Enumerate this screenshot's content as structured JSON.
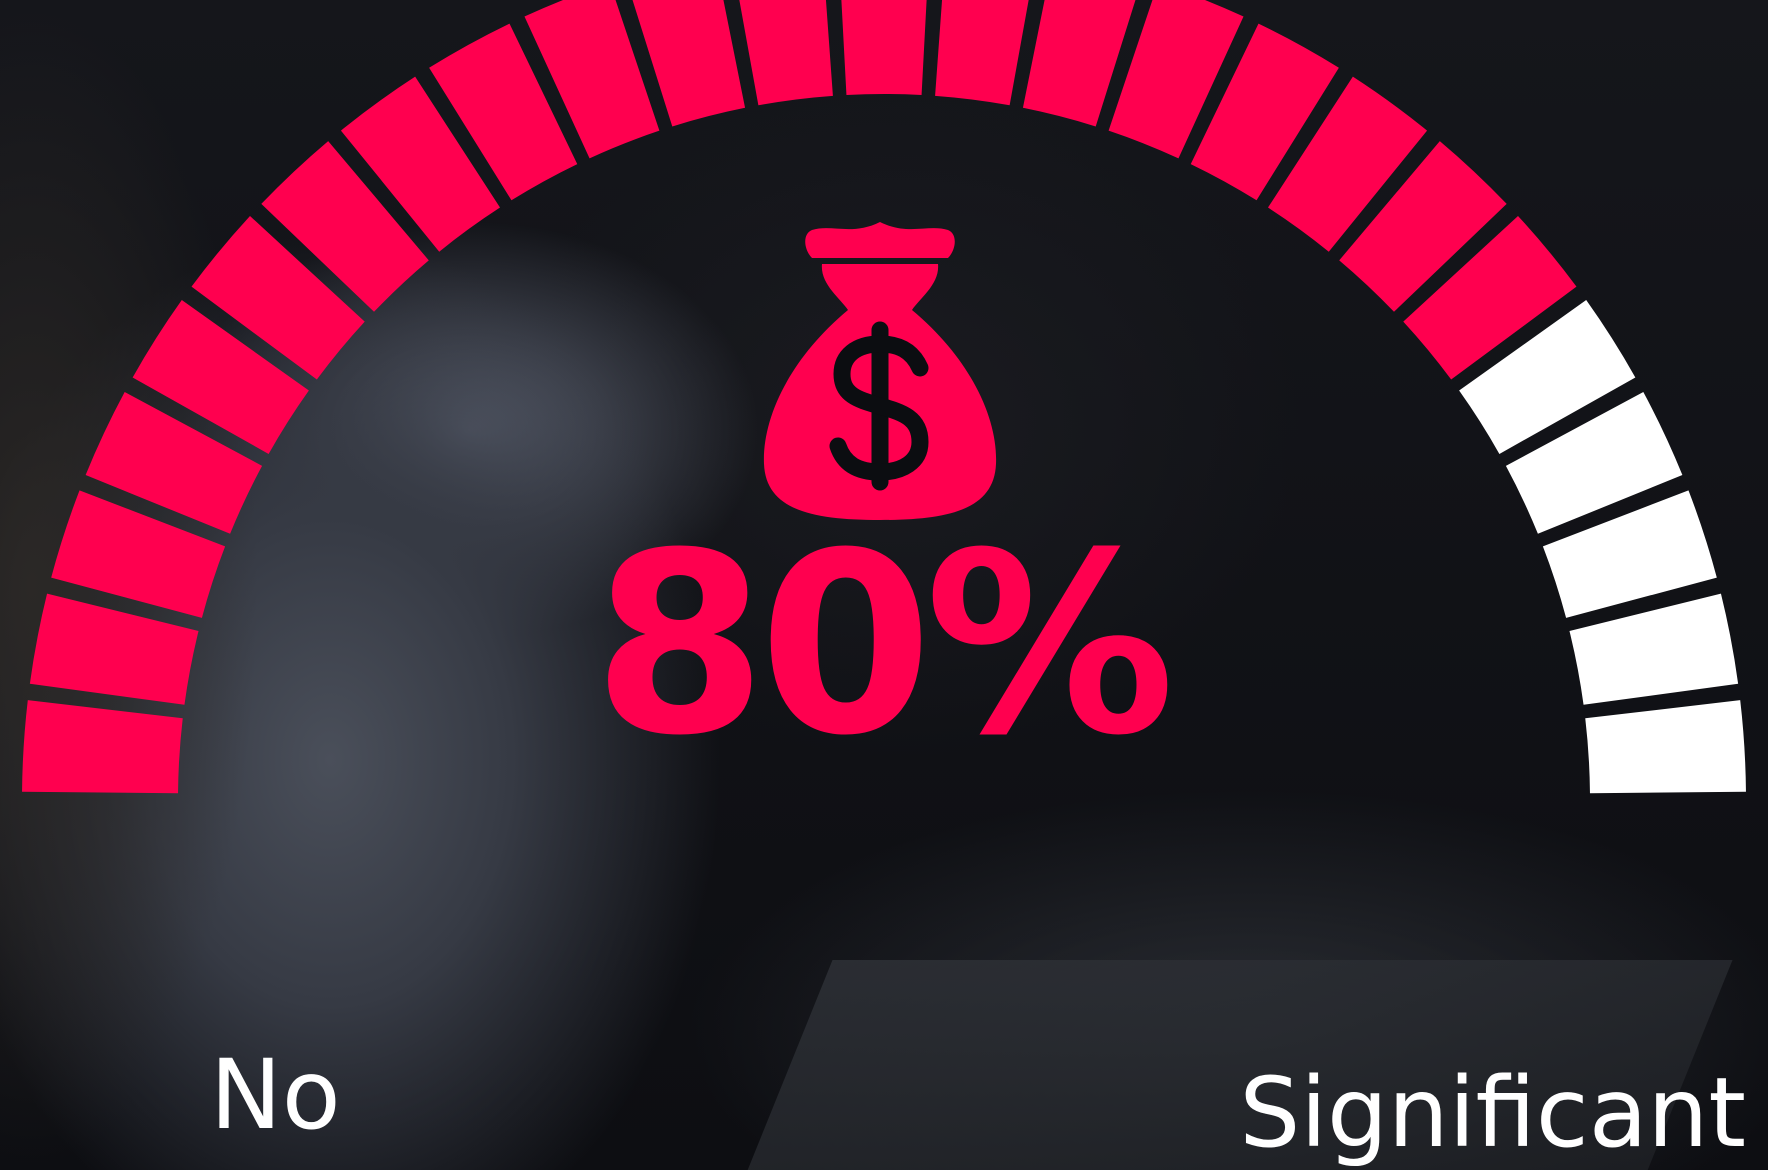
{
  "gauge": {
    "value_percent": 80,
    "display_value": "80%",
    "segment_count": 25,
    "filled_segments": 20,
    "colors": {
      "filled": "#ff004f",
      "empty": "#ffffff",
      "background": "#0c0d11"
    },
    "min_label": "No",
    "max_label": "Significant",
    "icon": "money-bag-dollar-icon"
  }
}
